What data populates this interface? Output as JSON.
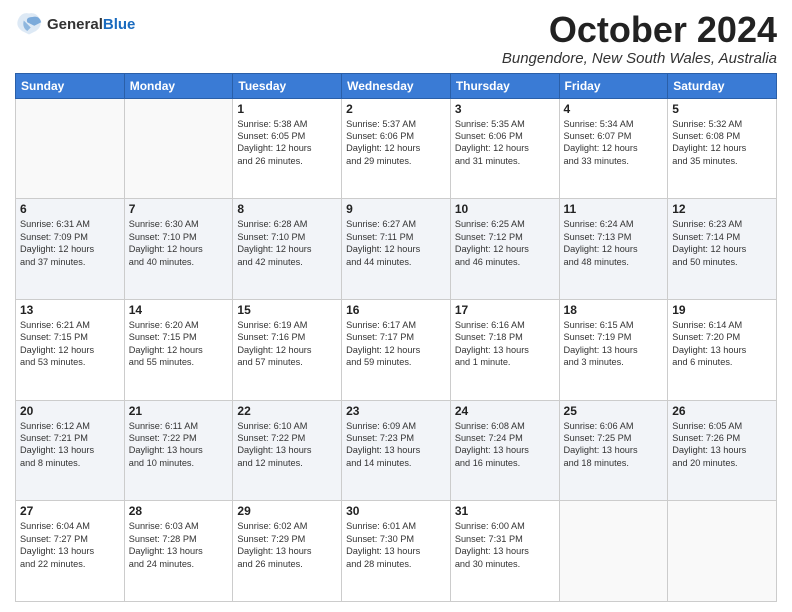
{
  "header": {
    "logo_general": "General",
    "logo_blue": "Blue",
    "title": "October 2024",
    "location": "Bungendore, New South Wales, Australia"
  },
  "days_of_week": [
    "Sunday",
    "Monday",
    "Tuesday",
    "Wednesday",
    "Thursday",
    "Friday",
    "Saturday"
  ],
  "weeks": [
    [
      {
        "day": "",
        "info": ""
      },
      {
        "day": "",
        "info": ""
      },
      {
        "day": "1",
        "info": "Sunrise: 5:38 AM\nSunset: 6:05 PM\nDaylight: 12 hours\nand 26 minutes."
      },
      {
        "day": "2",
        "info": "Sunrise: 5:37 AM\nSunset: 6:06 PM\nDaylight: 12 hours\nand 29 minutes."
      },
      {
        "day": "3",
        "info": "Sunrise: 5:35 AM\nSunset: 6:06 PM\nDaylight: 12 hours\nand 31 minutes."
      },
      {
        "day": "4",
        "info": "Sunrise: 5:34 AM\nSunset: 6:07 PM\nDaylight: 12 hours\nand 33 minutes."
      },
      {
        "day": "5",
        "info": "Sunrise: 5:32 AM\nSunset: 6:08 PM\nDaylight: 12 hours\nand 35 minutes."
      }
    ],
    [
      {
        "day": "6",
        "info": "Sunrise: 6:31 AM\nSunset: 7:09 PM\nDaylight: 12 hours\nand 37 minutes."
      },
      {
        "day": "7",
        "info": "Sunrise: 6:30 AM\nSunset: 7:10 PM\nDaylight: 12 hours\nand 40 minutes."
      },
      {
        "day": "8",
        "info": "Sunrise: 6:28 AM\nSunset: 7:10 PM\nDaylight: 12 hours\nand 42 minutes."
      },
      {
        "day": "9",
        "info": "Sunrise: 6:27 AM\nSunset: 7:11 PM\nDaylight: 12 hours\nand 44 minutes."
      },
      {
        "day": "10",
        "info": "Sunrise: 6:25 AM\nSunset: 7:12 PM\nDaylight: 12 hours\nand 46 minutes."
      },
      {
        "day": "11",
        "info": "Sunrise: 6:24 AM\nSunset: 7:13 PM\nDaylight: 12 hours\nand 48 minutes."
      },
      {
        "day": "12",
        "info": "Sunrise: 6:23 AM\nSunset: 7:14 PM\nDaylight: 12 hours\nand 50 minutes."
      }
    ],
    [
      {
        "day": "13",
        "info": "Sunrise: 6:21 AM\nSunset: 7:15 PM\nDaylight: 12 hours\nand 53 minutes."
      },
      {
        "day": "14",
        "info": "Sunrise: 6:20 AM\nSunset: 7:15 PM\nDaylight: 12 hours\nand 55 minutes."
      },
      {
        "day": "15",
        "info": "Sunrise: 6:19 AM\nSunset: 7:16 PM\nDaylight: 12 hours\nand 57 minutes."
      },
      {
        "day": "16",
        "info": "Sunrise: 6:17 AM\nSunset: 7:17 PM\nDaylight: 12 hours\nand 59 minutes."
      },
      {
        "day": "17",
        "info": "Sunrise: 6:16 AM\nSunset: 7:18 PM\nDaylight: 13 hours\nand 1 minute."
      },
      {
        "day": "18",
        "info": "Sunrise: 6:15 AM\nSunset: 7:19 PM\nDaylight: 13 hours\nand 3 minutes."
      },
      {
        "day": "19",
        "info": "Sunrise: 6:14 AM\nSunset: 7:20 PM\nDaylight: 13 hours\nand 6 minutes."
      }
    ],
    [
      {
        "day": "20",
        "info": "Sunrise: 6:12 AM\nSunset: 7:21 PM\nDaylight: 13 hours\nand 8 minutes."
      },
      {
        "day": "21",
        "info": "Sunrise: 6:11 AM\nSunset: 7:22 PM\nDaylight: 13 hours\nand 10 minutes."
      },
      {
        "day": "22",
        "info": "Sunrise: 6:10 AM\nSunset: 7:22 PM\nDaylight: 13 hours\nand 12 minutes."
      },
      {
        "day": "23",
        "info": "Sunrise: 6:09 AM\nSunset: 7:23 PM\nDaylight: 13 hours\nand 14 minutes."
      },
      {
        "day": "24",
        "info": "Sunrise: 6:08 AM\nSunset: 7:24 PM\nDaylight: 13 hours\nand 16 minutes."
      },
      {
        "day": "25",
        "info": "Sunrise: 6:06 AM\nSunset: 7:25 PM\nDaylight: 13 hours\nand 18 minutes."
      },
      {
        "day": "26",
        "info": "Sunrise: 6:05 AM\nSunset: 7:26 PM\nDaylight: 13 hours\nand 20 minutes."
      }
    ],
    [
      {
        "day": "27",
        "info": "Sunrise: 6:04 AM\nSunset: 7:27 PM\nDaylight: 13 hours\nand 22 minutes."
      },
      {
        "day": "28",
        "info": "Sunrise: 6:03 AM\nSunset: 7:28 PM\nDaylight: 13 hours\nand 24 minutes."
      },
      {
        "day": "29",
        "info": "Sunrise: 6:02 AM\nSunset: 7:29 PM\nDaylight: 13 hours\nand 26 minutes."
      },
      {
        "day": "30",
        "info": "Sunrise: 6:01 AM\nSunset: 7:30 PM\nDaylight: 13 hours\nand 28 minutes."
      },
      {
        "day": "31",
        "info": "Sunrise: 6:00 AM\nSunset: 7:31 PM\nDaylight: 13 hours\nand 30 minutes."
      },
      {
        "day": "",
        "info": ""
      },
      {
        "day": "",
        "info": ""
      }
    ]
  ]
}
